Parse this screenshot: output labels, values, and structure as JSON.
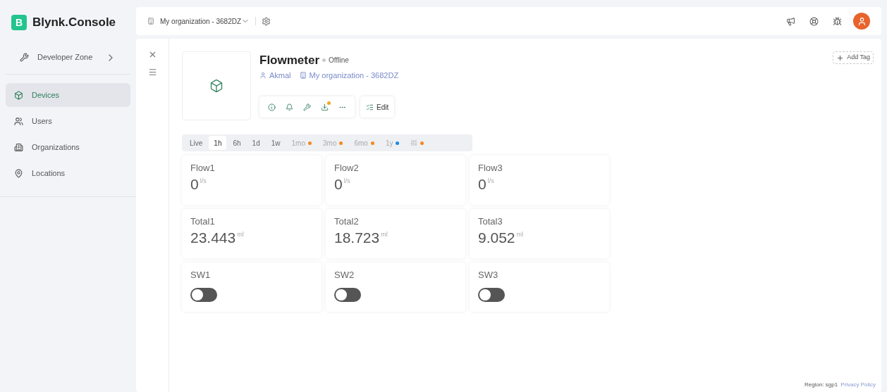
{
  "brand": {
    "badge": "B",
    "name": "Blynk.Console"
  },
  "sidebar": {
    "developer_zone": "Developer Zone",
    "items": [
      {
        "label": "Devices",
        "selected": true
      },
      {
        "label": "Users",
        "selected": false
      },
      {
        "label": "Organizations",
        "selected": false
      },
      {
        "label": "Locations",
        "selected": false
      }
    ]
  },
  "topbar": {
    "organization": "My organization - 3682DZ"
  },
  "device": {
    "name": "Flowmeter",
    "status": "Offline",
    "online": false,
    "owner": "Akmal",
    "organization": "My organization - 3682DZ",
    "edit": "Edit",
    "add_tag": "Add Tag"
  },
  "time_ranges": [
    {
      "kind": "text",
      "label": "Live",
      "selected": false,
      "disabled": false
    },
    {
      "kind": "text",
      "label": "1h",
      "selected": true,
      "disabled": false
    },
    {
      "kind": "text",
      "label": "6h",
      "selected": false,
      "disabled": false
    },
    {
      "kind": "text",
      "label": "1d",
      "selected": false,
      "disabled": false
    },
    {
      "kind": "text",
      "label": "1w",
      "selected": false,
      "disabled": false
    },
    {
      "kind": "text",
      "label": "1mo",
      "selected": false,
      "disabled": true,
      "color": "#f08c1c"
    },
    {
      "kind": "text",
      "label": "3mo",
      "selected": false,
      "disabled": true,
      "color": "#f08c1c"
    },
    {
      "kind": "text",
      "label": "6mo",
      "selected": false,
      "disabled": true,
      "color": "#f08c1c"
    },
    {
      "kind": "text",
      "label": "1y",
      "selected": false,
      "disabled": true,
      "color": "#1e88e5"
    },
    {
      "kind": "icon",
      "selected": false,
      "disabled": true,
      "color": "#f08c1c"
    }
  ],
  "tiles": [
    {
      "kind": "value",
      "title": "Flow1",
      "value": "0",
      "unit": "l/s"
    },
    {
      "kind": "value",
      "title": "Flow2",
      "value": "0",
      "unit": "l/s"
    },
    {
      "kind": "value",
      "title": "Flow3",
      "value": "0",
      "unit": "l/s"
    },
    {
      "kind": "value",
      "title": "Total1",
      "value": "23.443",
      "unit": "ml"
    },
    {
      "kind": "value",
      "title": "Total2",
      "value": "18.723",
      "unit": "ml"
    },
    {
      "kind": "value",
      "title": "Total3",
      "value": "9.052",
      "unit": "ml"
    },
    {
      "kind": "switch",
      "title": "SW1",
      "on": false
    },
    {
      "kind": "switch",
      "title": "SW2",
      "on": false
    },
    {
      "kind": "switch",
      "title": "SW3",
      "on": false
    }
  ],
  "footer": {
    "region": "Region: sgp1",
    "privacy": "Privacy Policy"
  }
}
